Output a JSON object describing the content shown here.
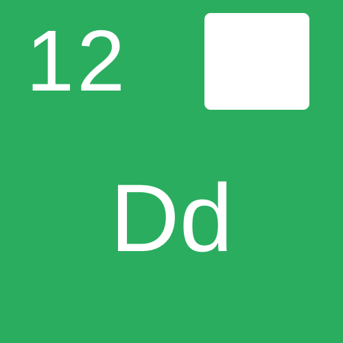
{
  "card": {
    "number": "12",
    "letters": "Dd",
    "background_color": "#2aad5f",
    "text_color": "#ffffff",
    "square_color": "#ffffff"
  }
}
